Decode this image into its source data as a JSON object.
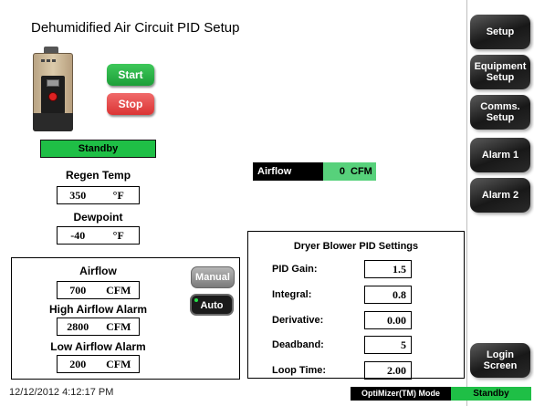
{
  "title": "Dehumidified Air Circuit PID Setup",
  "controls": {
    "start_label": "Start",
    "stop_label": "Stop"
  },
  "status": {
    "text": "Standby",
    "color": "#1fbf46"
  },
  "regen_temp": {
    "label": "Regen Temp",
    "value": "350",
    "unit": "°F"
  },
  "dewpoint": {
    "label": "Dewpoint",
    "value": "-40",
    "unit": "°F"
  },
  "airflow_display": {
    "label": "Airflow",
    "value": "0",
    "unit": "CFM"
  },
  "airflow_settings": {
    "airflow": {
      "label": "Airflow",
      "value": "700",
      "unit": "CFM"
    },
    "high_alarm": {
      "label": "High Airflow Alarm",
      "value": "2800",
      "unit": "CFM"
    },
    "low_alarm": {
      "label": "Low Airflow Alarm",
      "value": "200",
      "unit": "CFM"
    }
  },
  "mode_buttons": {
    "manual_label": "Manual",
    "auto_label": "Auto"
  },
  "pid": {
    "title": "Dryer Blower PID Settings",
    "rows": [
      {
        "label": "PID Gain:",
        "value": "1.5"
      },
      {
        "label": "Integral:",
        "value": "0.8"
      },
      {
        "label": "Derivative:",
        "value": "0.00"
      },
      {
        "label": "Deadband:",
        "value": "5"
      },
      {
        "label": "Loop Time:",
        "value": "2.00"
      }
    ]
  },
  "nav": {
    "setup": "Setup",
    "equipment_setup": "Equipment\nSetup",
    "comms_setup": "Comms.\nSetup",
    "alarm1": "Alarm 1",
    "alarm2": "Alarm 2",
    "login": "Login\nScreen"
  },
  "footer": {
    "timestamp": "12/12/2012 4:12:17 PM",
    "mode_label": "OptiMizer(TM) Mode",
    "mode_value": "Standby"
  }
}
